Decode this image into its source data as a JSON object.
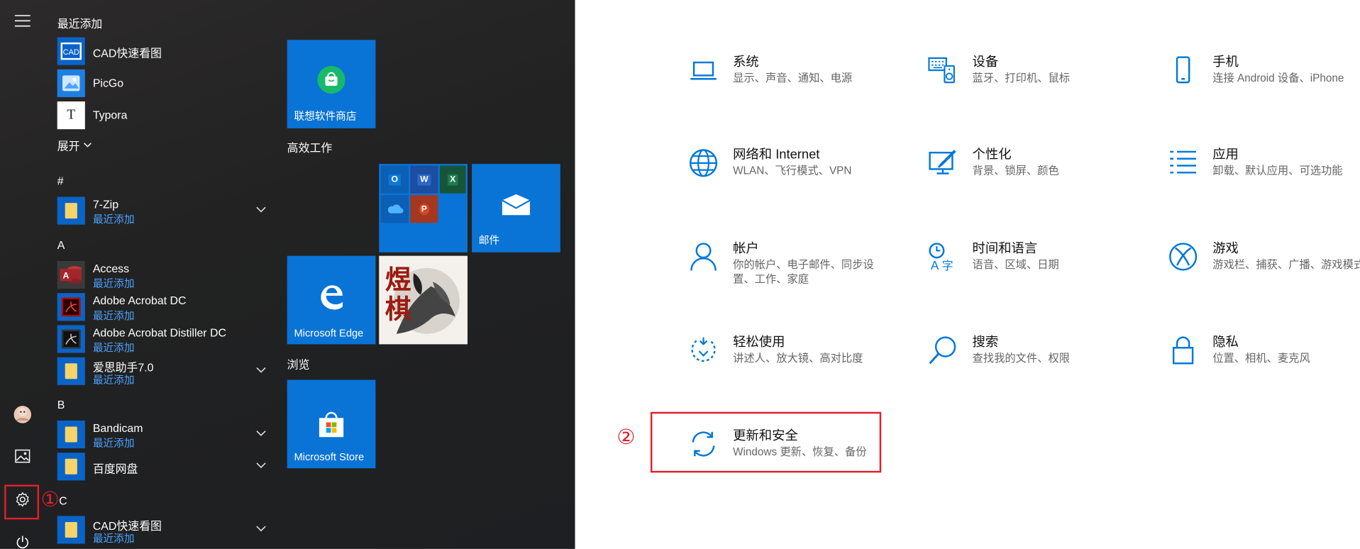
{
  "start_menu": {
    "recent_header": "最近添加",
    "recent": [
      {
        "name": "CAD快速看图"
      },
      {
        "name": "PicGo"
      },
      {
        "name": "Typora"
      }
    ],
    "expand_label": "展开",
    "sections": {
      "hash": "#",
      "a": "A",
      "b": "B",
      "c": "C"
    },
    "apps": [
      {
        "name": "7-Zip",
        "sub": "最近添加"
      },
      {
        "name": "Access",
        "sub": "最近添加"
      },
      {
        "name": "Adobe Acrobat DC",
        "sub": "最近添加"
      },
      {
        "name": "Adobe Acrobat Distiller DC",
        "sub": "最近添加"
      },
      {
        "name": "爱思助手7.0",
        "sub": "最近添加"
      },
      {
        "name": "Bandicam",
        "sub": "最近添加"
      },
      {
        "name": "百度网盘",
        "sub": ""
      },
      {
        "name": "CAD快速看图",
        "sub": "最近添加"
      }
    ],
    "tiles": {
      "lenovo_store": "联想软件商店",
      "group_work": "高效工作",
      "mail": "邮件",
      "edge": "Microsoft Edge",
      "group_browse": "浏览",
      "store": "Microsoft Store",
      "photo_text": "煜棋"
    },
    "office_apps": [
      "O",
      "W",
      "X",
      "",
      "P"
    ]
  },
  "settings": {
    "items": [
      {
        "title": "系统",
        "desc": "显示、声音、通知、电源"
      },
      {
        "title": "设备",
        "desc": "蓝牙、打印机、鼠标"
      },
      {
        "title": "手机",
        "desc": "连接 Android 设备、iPhone"
      },
      {
        "title": "网络和 Internet",
        "desc": "WLAN、飞行模式、VPN"
      },
      {
        "title": "个性化",
        "desc": "背景、锁屏、颜色"
      },
      {
        "title": "应用",
        "desc": "卸载、默认应用、可选功能"
      },
      {
        "title": "帐户",
        "desc": "你的帐户、电子邮件、同步设置、工作、家庭"
      },
      {
        "title": "时间和语言",
        "desc": "语音、区域、日期"
      },
      {
        "title": "游戏",
        "desc": "游戏栏、捕获、广播、游戏模式"
      },
      {
        "title": "轻松使用",
        "desc": "讲述人、放大镜、高对比度"
      },
      {
        "title": "搜索",
        "desc": "查找我的文件、权限"
      },
      {
        "title": "隐私",
        "desc": "位置、相机、麦克风"
      },
      {
        "title": "更新和安全",
        "desc": "Windows 更新、恢复、备份"
      }
    ]
  },
  "annotations": {
    "one": "①",
    "two": "②"
  },
  "colors": {
    "accent": "#0078d7",
    "tile": "#0a73d6",
    "highlight": "#e0202a"
  }
}
